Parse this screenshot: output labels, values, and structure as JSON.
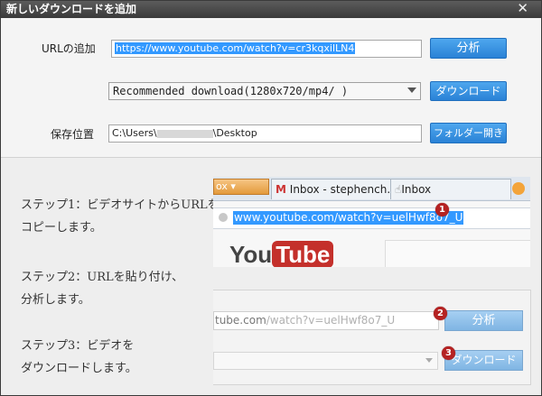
{
  "window": {
    "title": "新しいダウンロードを追加",
    "close": "✕"
  },
  "form": {
    "url_label": "URLの追加",
    "url_value": "https://www.youtube.com/watch?v=cr3kqxilLN4",
    "analyze_button": "分析",
    "format_value": "Recommended download(1280x720/mp4/ )",
    "download_button": "ダウンロード",
    "save_label": "保存位置",
    "path_prefix": "C:\\Users\\",
    "path_suffix": "\\Desktop",
    "open_folder_button": "フォルダー開き"
  },
  "guide": {
    "step1_line1": "ステップ1：ビデオサイトからURLを",
    "step1_line2": "コピーします。",
    "step2_line1": "ステップ2：URLを貼り付け、",
    "step2_line2": "分析します。",
    "step3_line1": "ステップ3：ビデオを",
    "step3_line2": "ダウンロードします。",
    "browser_tab_partial": "ox ▾",
    "tab1": "Inbox - stephench...",
    "tab2": "Inbox",
    "address": "www.youtube.com/watch?v=uelHwf8o7_U",
    "logo_you": "You",
    "logo_tube": "Tube",
    "url_partial_dark": "tube.com",
    "url_partial_light": "/watch?v=uelHwf8o7_U",
    "analyze_button": "分析",
    "download_button": "ダウンロード",
    "badge1": "1",
    "badge2": "2",
    "badge3": "3"
  }
}
